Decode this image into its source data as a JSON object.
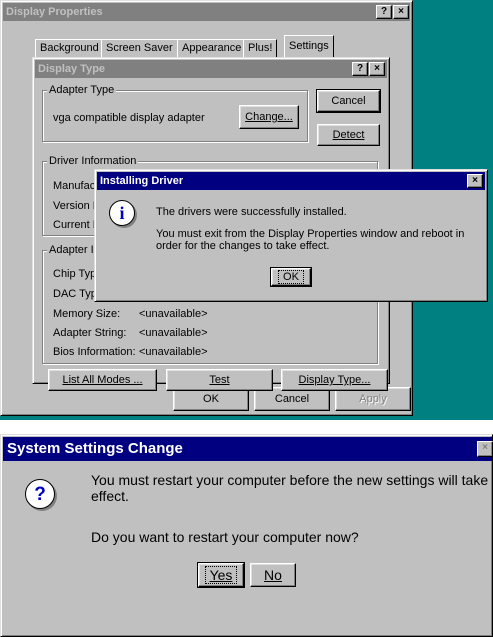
{
  "display_properties": {
    "title": "Display Properties",
    "help_btn": "?",
    "close_btn": "×",
    "tabs": [
      "Background",
      "Screen Saver",
      "Appearance",
      "Plus!",
      "Settings"
    ],
    "ok": "OK",
    "cancel": "Cancel",
    "apply": "Apply"
  },
  "display_type": {
    "title": "Display Type",
    "help_btn": "?",
    "close_btn": "×",
    "adapter_group": "Adapter Type",
    "adapter_value": "vga compatible display adapter",
    "change_btn": "Change...",
    "cancel_btn": "Cancel",
    "detect_btn": "Detect",
    "driver_group": "Driver Information",
    "driver_rows": [
      "Manufact",
      "Version N",
      "Current Fi"
    ],
    "adapter_info_group": "Adapter In",
    "info_rows": [
      {
        "label": "Chip Type",
        "value": ""
      },
      {
        "label": "DAC Type",
        "value": ""
      },
      {
        "label": "Memory Size:",
        "value": "<unavailable>"
      },
      {
        "label": "Adapter String:",
        "value": "<unavailable>"
      },
      {
        "label": "Bios Information:",
        "value": "<unavailable>"
      }
    ],
    "list_modes_btn": "List All Modes ...",
    "test_btn": "Test",
    "display_type_btn": "Display Type..."
  },
  "installing": {
    "title": "Installing Driver",
    "close_btn": "×",
    "icon": "i",
    "line1": "The drivers were successfully installed.",
    "line2": "You must exit from the Display Properties window and reboot in order for the changes to take effect.",
    "ok": "OK"
  },
  "system_settings": {
    "title": "System Settings Change",
    "close_btn": "×",
    "icon": "?",
    "message": "You must restart your computer before the new settings will take effect.",
    "question": "Do you want to restart your computer now?",
    "yes": "Yes",
    "no": "No"
  },
  "colors": {
    "desktop": "#008080",
    "title_active": "#000080",
    "title_inactive": "#808080",
    "face": "#c0c0c0"
  }
}
